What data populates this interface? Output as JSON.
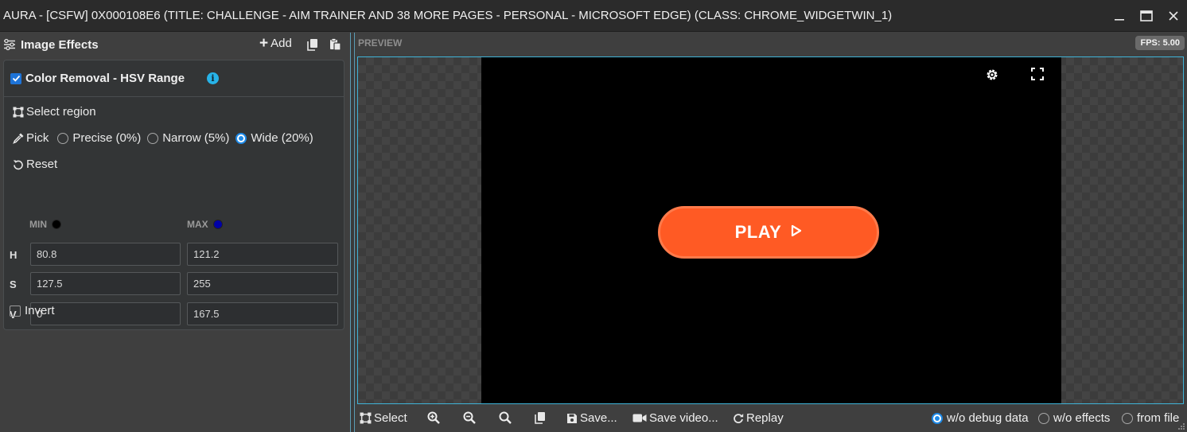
{
  "window": {
    "title": "AURA - [CSFW] 0X000108E6 (TITLE: CHALLENGE - AIM TRAINER AND 38 MORE PAGES - PERSONAL - MICROSOFT EDGE) (CLASS: CHROME_WIDGETWIN_1)"
  },
  "left_panel": {
    "title": "Image Effects",
    "add_label": "Add",
    "effect": {
      "name": "Color Removal - HSV Range",
      "enabled": true,
      "select_region_label": "Select region",
      "pick_label": "Pick",
      "pick_options": [
        {
          "label": "Precise (0%)",
          "selected": false
        },
        {
          "label": "Narrow (5%)",
          "selected": false
        },
        {
          "label": "Wide (20%)",
          "selected": true
        }
      ],
      "reset_label": "Reset",
      "min_label": "MIN",
      "max_label": "MAX",
      "min_color": "#000000",
      "max_color": "#0000a8",
      "rows": [
        {
          "label": "H",
          "min": "80.8",
          "max": "121.2"
        },
        {
          "label": "S",
          "min": "127.5",
          "max": "255"
        },
        {
          "label": "V",
          "min": "0",
          "max": "167.5"
        }
      ],
      "invert_label": "Invert",
      "invert_checked": false
    }
  },
  "preview": {
    "label": "PREVIEW",
    "fps": "FPS: 5.00",
    "play_label": "PLAY",
    "play_color": "#ff5a24"
  },
  "toolbar": {
    "select": "Select",
    "save": "Save...",
    "save_video": "Save video...",
    "replay": "Replay",
    "modes": [
      {
        "label": "w/o debug data",
        "selected": true
      },
      {
        "label": "w/o effects",
        "selected": false
      },
      {
        "label": "from file",
        "selected": false
      }
    ]
  }
}
